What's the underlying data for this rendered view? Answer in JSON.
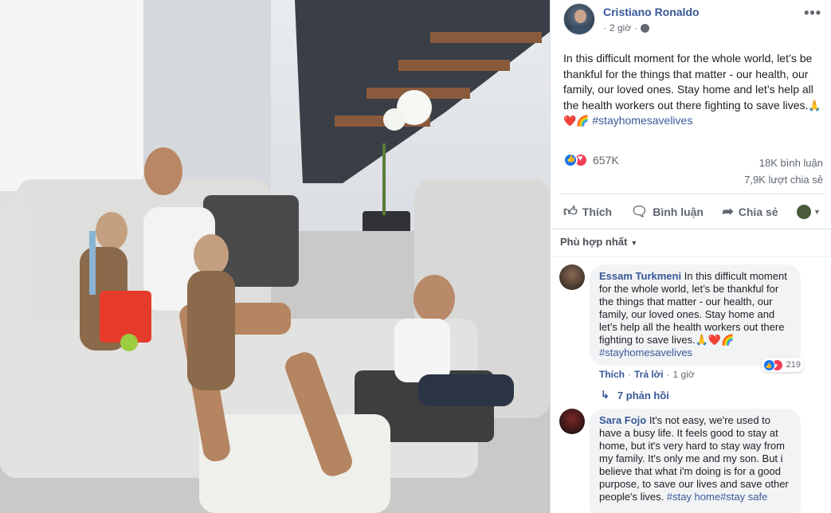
{
  "post": {
    "author": "Cristiano Ronaldo",
    "time": "2 giờ",
    "text_main": "In this difficult moment for the whole world, let’s be thankful for the things that matter - our health, our family, our loved ones. Stay home and let’s help all the health workers out there fighting to save lives.",
    "emojis": "🙏❤️🌈",
    "hashtag": "#stayhomesavelives",
    "reaction_count": "657K",
    "comments_count": "18K bình luận",
    "shares_count": "7,9K lượt chia sẻ"
  },
  "actions": {
    "like": "Thích",
    "comment": "Bình luận",
    "share": "Chia sẻ"
  },
  "sort": {
    "label": "Phù hợp nhất"
  },
  "comments": [
    {
      "name": "Essam Turkmeni",
      "text": "In this difficult moment for the whole world, let’s be thankful for the things that matter - our health, our family, our loved ones. Stay home and let’s help all the health workers out there fighting to save lives.",
      "emojis": "🙏❤️🌈",
      "hashtag": "#stayhomesavelives",
      "like_label": "Thích",
      "reply_label": "Trả lời",
      "time": "1 giờ",
      "reactions": "219"
    },
    {
      "name": "Sara Fojo",
      "text": "It's not easy, we're used to have a busy life. It feels good to stay at home, but it's very hard to stay way from my family. It's only me and my son. But i believe that what i'm doing is for a good purpose, to save our lives and save other people's lives.",
      "hashtags": "#stay home#stay safe"
    }
  ],
  "replies": {
    "label": "7 phản hồi"
  },
  "icons": {
    "menu": "more-dots-icon",
    "globe": "globe-icon",
    "like": "thumbs-up-icon",
    "comment": "comment-bubble-icon",
    "share": "share-arrow-icon"
  },
  "colors": {
    "link": "#385898",
    "like_blue": "#1877f2",
    "love_red": "#f33e58"
  }
}
